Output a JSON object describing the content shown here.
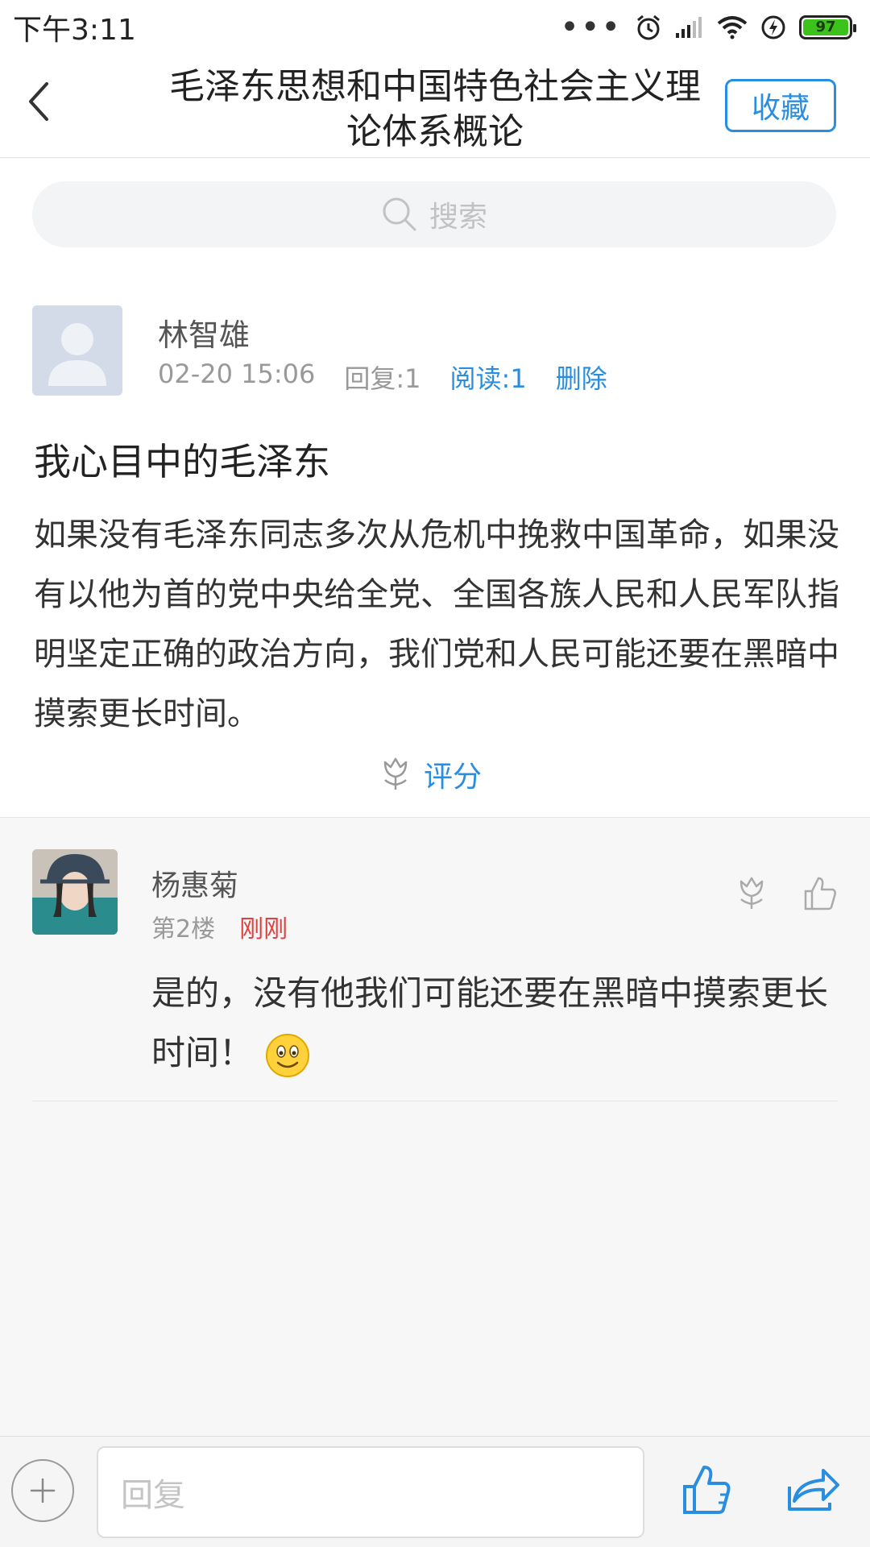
{
  "status_bar": {
    "time": "下午3:11",
    "dots": "•••",
    "battery": "97"
  },
  "header": {
    "title": "毛泽东思想和中国特色社会主义理论体系概论",
    "favorite_label": "收藏"
  },
  "search": {
    "placeholder": "搜索"
  },
  "post": {
    "author": "林智雄",
    "date": "02-20 15:06",
    "replies": "回复:1",
    "reads": "阅读:1",
    "delete_label": "删除",
    "title": "我心目中的毛泽东",
    "body": "如果没有毛泽东同志多次从危机中挽救中国革命，如果没有以他为首的党中央给全党、全国各族人民和人民军队指明坚定正确的政治方向，我们党和人民可能还要在黑暗中摸索更长时间。",
    "rate_label": "评分"
  },
  "reply": {
    "author": "杨惠菊",
    "floor": "第2楼",
    "time": "刚刚",
    "text": "是的，没有他我们可能还要在黑暗中摸索更长时间！"
  },
  "bottom_bar": {
    "reply_placeholder": "回复"
  },
  "colors": {
    "accent": "#2a8ee0",
    "time_red": "#e04040",
    "battery_green": "#3bc21b"
  },
  "icons": [
    "back-arrow-icon",
    "search-icon",
    "flower-icon",
    "thumbs-up-icon",
    "plus-icon",
    "share-icon",
    "smile-emoji-icon",
    "wifi-icon",
    "signal-icon",
    "alarm-icon",
    "charging-icon"
  ]
}
